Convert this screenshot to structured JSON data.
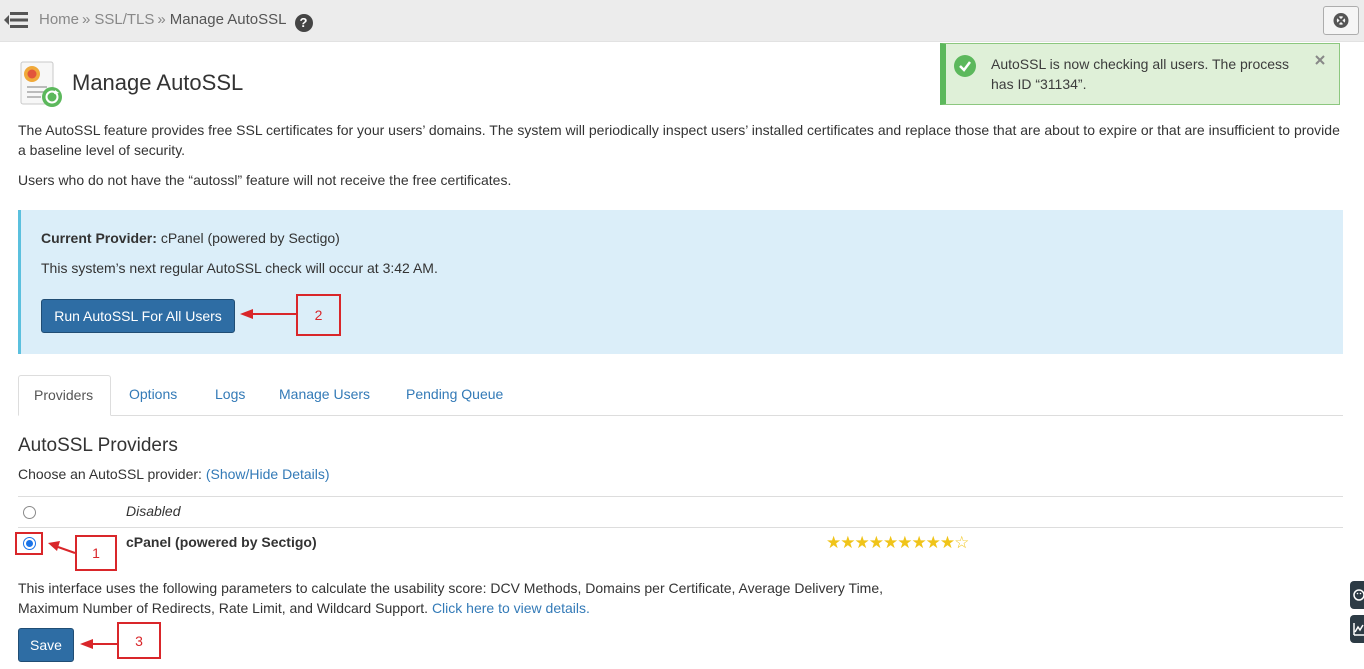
{
  "breadcrumb": {
    "home": "Home",
    "sep1": "»",
    "ssl": "SSL/TLS",
    "sep2": "»",
    "current": "Manage AutoSSL",
    "help": "?"
  },
  "page": {
    "title": "Manage AutoSSL",
    "intro_1": "The AutoSSL feature provides free SSL certificates for your users’ domains. The system will periodically inspect users’ installed certificates and replace those that are about to expire or that are insufficient to provide a baseline level of security.",
    "intro_2": "Users who do not have the “autossl” feature will not receive the free certificates."
  },
  "toast": {
    "message": "AutoSSL is now checking all users. The process has ID “31134”.",
    "close": "×"
  },
  "info": {
    "provider_label": "Current Provider:",
    "provider_value": "cPanel (powered by Sectigo)",
    "next_check": "This system’s next regular AutoSSL check will occur at 3:42 AM.",
    "run_button": "Run AutoSSL For All Users"
  },
  "tabs": [
    {
      "label": "Providers",
      "active": true
    },
    {
      "label": "Options"
    },
    {
      "label": "Logs"
    },
    {
      "label": "Manage Users"
    },
    {
      "label": "Pending Queue"
    }
  ],
  "providers": {
    "heading": "AutoSSL Providers",
    "choose_text": "Choose an AutoSSL provider:",
    "details_link": "(Show/Hide Details)",
    "options": [
      {
        "label": "Disabled",
        "selected": false
      },
      {
        "label": "cPanel (powered by Sectigo)",
        "selected": true,
        "rating": 9,
        "rating_max": 10
      }
    ],
    "stars_filled": "★★★★★★★★★",
    "stars_empty": "☆",
    "usability_text": "This interface uses the following parameters to calculate the usability score: DCV Methods, Domains per Certificate, Average Delivery Time, Maximum Number of Redirects, Rate Limit, and Wildcard Support.",
    "usability_link": "Click here to view details.",
    "save_button": "Save"
  },
  "annotations": [
    "1",
    "2",
    "3"
  ],
  "icons": {
    "menu": "menu-collapse-icon",
    "help": "help-icon",
    "close": "close-circle-icon",
    "page": "autossl-certificate-icon",
    "toast": "check-circle-icon"
  },
  "colors": {
    "primary_button": "#2e6da4",
    "info_bg": "#dbeef9",
    "toast_bg": "#dff0d8",
    "annotation": "#d9262a",
    "star": "#f0c419",
    "link": "#337ab7"
  }
}
